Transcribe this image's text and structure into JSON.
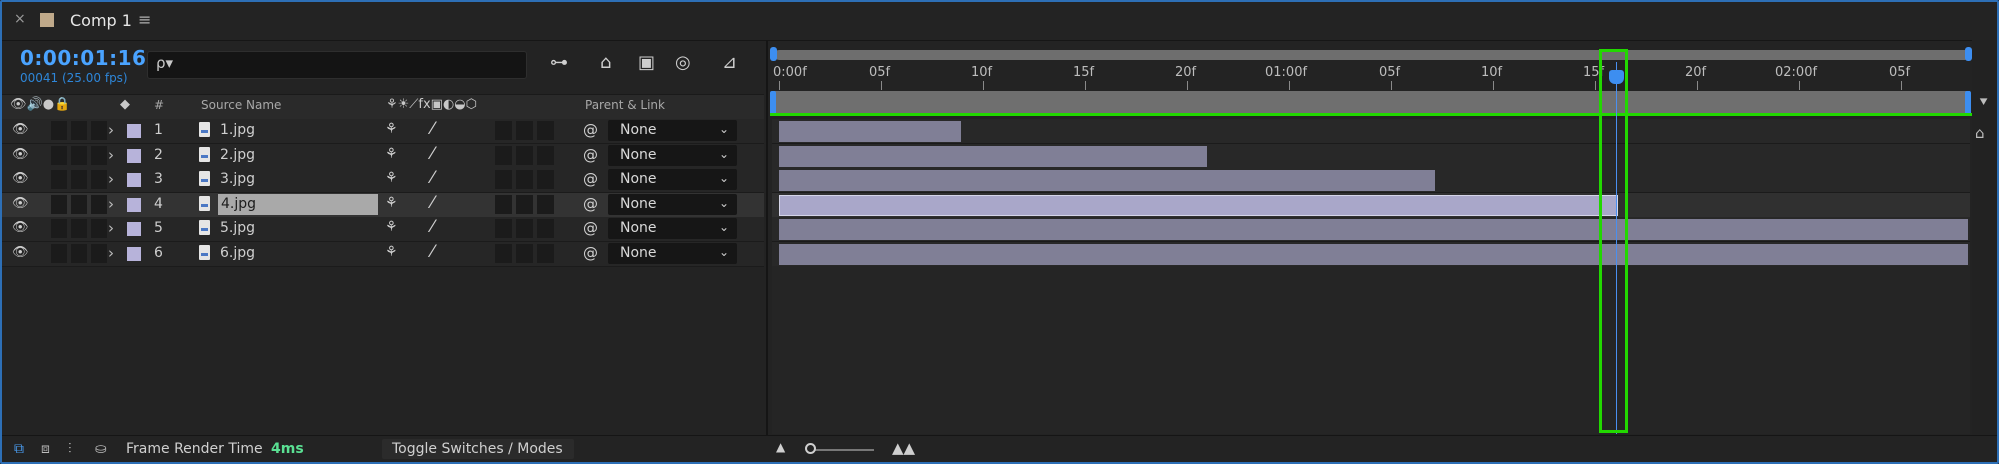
{
  "tab": {
    "close": "×",
    "title": "Comp 1",
    "menu": "≡"
  },
  "timecode": "0:00:01:16",
  "frame_info": "00041 (25.00 fps)",
  "search": {
    "icon": "ρ▾",
    "placeholder": ""
  },
  "toolbar": {
    "icons": [
      "composition-flowchart-icon",
      "draft-3d-icon",
      "frame-blending-icon",
      "motion-blur-icon",
      "graph-editor-icon"
    ],
    "glyphs": [
      "⊶",
      "⌂",
      "▣",
      "◎",
      "⊿"
    ]
  },
  "headers": {
    "av_icons": "👁🔊●🔒",
    "label_icon": "◆",
    "hash": "#",
    "source_name": "Source Name",
    "switch_icons": "⚘☀⟋fx▣◐◒⬡",
    "parent_link": "Parent & Link"
  },
  "layers": [
    {
      "num": "1",
      "name": "1.jpg",
      "parent": "None",
      "selected": false,
      "bar_end": 0.153
    },
    {
      "num": "2",
      "name": "2.jpg",
      "parent": "None",
      "selected": false,
      "bar_end": 0.36
    },
    {
      "num": "3",
      "name": "3.jpg",
      "parent": "None",
      "selected": false,
      "bar_end": 0.552
    },
    {
      "num": "4",
      "name": "4.jpg",
      "parent": "None",
      "selected": true,
      "bar_end": 0.706
    },
    {
      "num": "5",
      "name": "5.jpg",
      "parent": "None",
      "selected": false,
      "bar_end": 1.0
    },
    {
      "num": "6",
      "name": "6.jpg",
      "parent": "None",
      "selected": false,
      "bar_end": 1.0
    }
  ],
  "row_glyphs": {
    "eye": "●",
    "caret": "›",
    "shy": "⚘",
    "slash": "⁄",
    "pick": "@",
    "chevron": "⌄"
  },
  "ruler_labels": [
    "0:00f",
    "05f",
    "10f",
    "15f",
    "20f",
    "01:00f",
    "05f",
    "10f",
    "15f",
    "20f",
    "02:00f",
    "05f"
  ],
  "footer": {
    "icons": [
      "⧉",
      "⧈",
      "⫶",
      "⛀"
    ],
    "frame_render_time_label": "Frame Render Time",
    "frame_render_time_value": "4ms",
    "toggle_label": "Toggle Switches / Modes",
    "zoom_out": "▲",
    "zoom_in": "▲▲"
  },
  "colors": {
    "accent": "#3d8ef0",
    "highlight": "#22d800",
    "layer_bar": "#807f96",
    "layer_bar_selected": "#a9a7c9"
  }
}
